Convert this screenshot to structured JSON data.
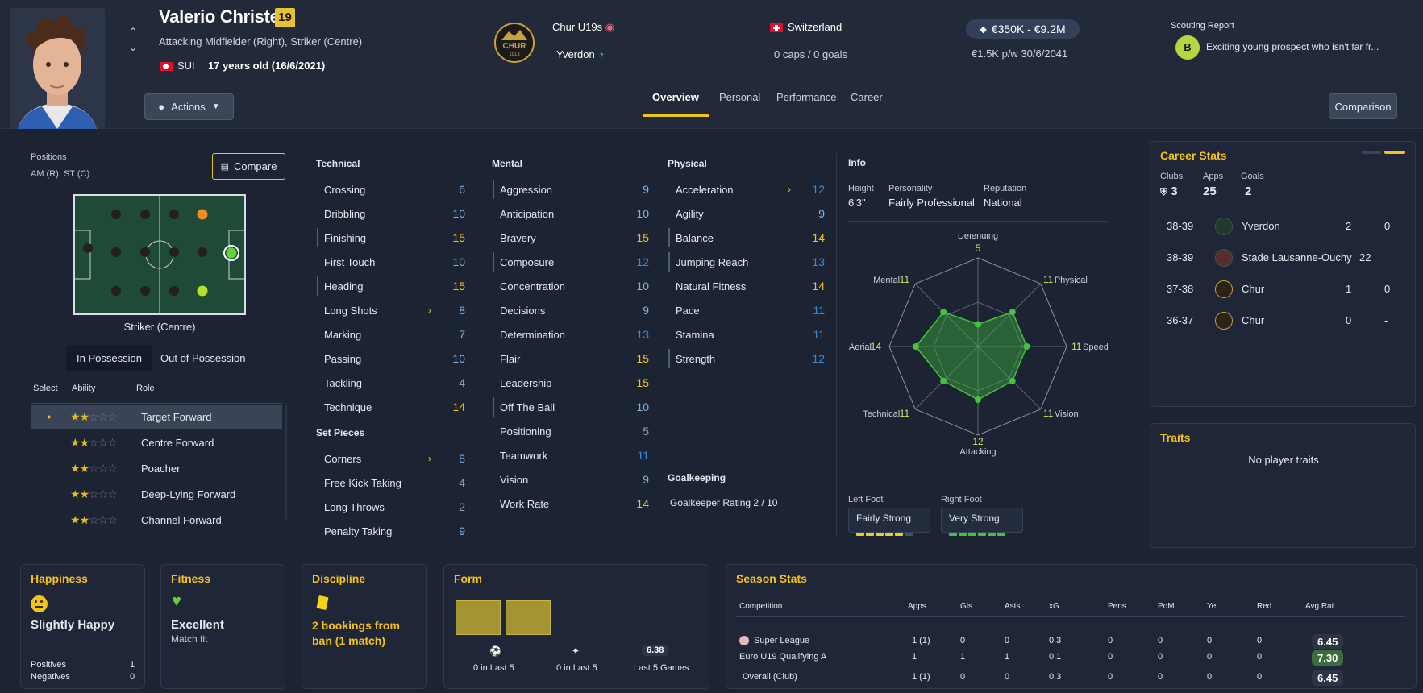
{
  "player": {
    "name": "Valerio Christen",
    "age_badge": "19",
    "positions_text": "Attacking Midfielder (Right), Striker (Centre)",
    "nation_code": "SUI",
    "age_text": "17 years old (16/6/2021)"
  },
  "clubs": {
    "club": "Chur U19s",
    "loan_club": "Yverdon",
    "logo_text": "CHUR",
    "logo_year": "1913"
  },
  "nation": {
    "name": "Switzerland",
    "caps": "0 caps / 0 goals"
  },
  "value": {
    "range": "€350K - €9.2M",
    "wage": "€1.5K p/w 30/6/2041"
  },
  "scouting": {
    "label": "Scouting Report",
    "grade": "B",
    "text": "Exciting young prospect who isn't far fr..."
  },
  "actions_label": "Actions",
  "comparison_label": "Comparison",
  "tabs": [
    "Overview",
    "Personal",
    "Performance",
    "Career"
  ],
  "positions_panel": {
    "label": "Positions",
    "value": "AM (R), ST (C)",
    "compare_label": "Compare",
    "pitch_caption": "Striker (Centre)",
    "in_possession": "In Possession",
    "out_possession": "Out of Possession",
    "headers": [
      "Select",
      "Ability",
      "Role"
    ],
    "roles": [
      {
        "name": "Target Forward",
        "stars": 2,
        "selected": true
      },
      {
        "name": "Centre Forward",
        "stars": 2,
        "selected": false
      },
      {
        "name": "Poacher",
        "stars": 2,
        "selected": false
      },
      {
        "name": "Deep-Lying Forward",
        "stars": 2,
        "selected": false
      },
      {
        "name": "Channel Forward",
        "stars": 2,
        "selected": false
      }
    ]
  },
  "attributes": {
    "technical_title": "Technical",
    "technical": [
      {
        "n": "Crossing",
        "v": "6"
      },
      {
        "n": "Dribbling",
        "v": "10"
      },
      {
        "n": "Finishing",
        "v": "15"
      },
      {
        "n": "First Touch",
        "v": "10"
      },
      {
        "n": "Heading",
        "v": "15"
      },
      {
        "n": "Long Shots",
        "v": "8"
      },
      {
        "n": "Marking",
        "v": "7"
      },
      {
        "n": "Passing",
        "v": "10"
      },
      {
        "n": "Tackling",
        "v": "4"
      },
      {
        "n": "Technique",
        "v": "14"
      }
    ],
    "set_pieces_title": "Set Pieces",
    "set_pieces": [
      {
        "n": "Corners",
        "v": "8"
      },
      {
        "n": "Free Kick Taking",
        "v": "4"
      },
      {
        "n": "Long Throws",
        "v": "2"
      },
      {
        "n": "Penalty Taking",
        "v": "9"
      }
    ],
    "mental_title": "Mental",
    "mental": [
      {
        "n": "Aggression",
        "v": "9"
      },
      {
        "n": "Anticipation",
        "v": "10"
      },
      {
        "n": "Bravery",
        "v": "15"
      },
      {
        "n": "Composure",
        "v": "12"
      },
      {
        "n": "Concentration",
        "v": "10"
      },
      {
        "n": "Decisions",
        "v": "9"
      },
      {
        "n": "Determination",
        "v": "13"
      },
      {
        "n": "Flair",
        "v": "15"
      },
      {
        "n": "Leadership",
        "v": "15"
      },
      {
        "n": "Off The Ball",
        "v": "10"
      },
      {
        "n": "Positioning",
        "v": "5"
      },
      {
        "n": "Teamwork",
        "v": "11"
      },
      {
        "n": "Vision",
        "v": "9"
      },
      {
        "n": "Work Rate",
        "v": "14"
      }
    ],
    "physical_title": "Physical",
    "physical": [
      {
        "n": "Acceleration",
        "v": "12"
      },
      {
        "n": "Agility",
        "v": "9"
      },
      {
        "n": "Balance",
        "v": "14"
      },
      {
        "n": "Jumping Reach",
        "v": "13"
      },
      {
        "n": "Natural Fitness",
        "v": "14"
      },
      {
        "n": "Pace",
        "v": "11"
      },
      {
        "n": "Stamina",
        "v": "11"
      },
      {
        "n": "Strength",
        "v": "12"
      }
    ],
    "gk_title": "Goalkeeping",
    "gk_rating": "Goalkeeper Rating  2 / 10"
  },
  "info": {
    "title": "Info",
    "height_label": "Height",
    "height": "6'3\"",
    "personality_label": "Personality",
    "personality": "Fairly Professional",
    "reputation_label": "Reputation",
    "reputation": "National",
    "radar": [
      {
        "label": "Defending",
        "value": "5"
      },
      {
        "label": "Physical",
        "value": "11"
      },
      {
        "label": "Speed",
        "value": "11"
      },
      {
        "label": "Vision",
        "value": "11"
      },
      {
        "label": "Attacking",
        "value": "12"
      },
      {
        "label": "Technical",
        "value": "11"
      },
      {
        "label": "Aerial",
        "value": "14"
      },
      {
        "label": "Mental",
        "value": "11"
      }
    ],
    "left_foot_label": "Left Foot",
    "left_foot": "Fairly Strong",
    "left_foot_level": 0.8,
    "right_foot_label": "Right Foot",
    "right_foot": "Very Strong",
    "right_foot_level": 1.0
  },
  "career_stats": {
    "title": "Career Stats",
    "clubs_label": "Clubs",
    "clubs": "3",
    "apps_label": "Apps",
    "apps": "25",
    "goals_label": "Goals",
    "goals": "2",
    "rows": [
      {
        "season": "38-39",
        "club": "Yverdon",
        "apps": "2",
        "goals": "0"
      },
      {
        "season": "38-39",
        "club": "Stade Lausanne-Ouchy",
        "apps": "22",
        "goals": ""
      },
      {
        "season": "37-38",
        "club": "Chur",
        "apps": "1",
        "goals": "0"
      },
      {
        "season": "36-37",
        "club": "Chur",
        "apps": "0",
        "goals": "-"
      }
    ]
  },
  "traits": {
    "title": "Traits",
    "text": "No player traits"
  },
  "happiness": {
    "title": "Happiness",
    "value": "Slightly Happy",
    "positives_label": "Positives",
    "positives": "1",
    "negatives_label": "Negatives",
    "negatives": "0"
  },
  "fitness": {
    "title": "Fitness",
    "value": "Excellent",
    "sub": "Match fit"
  },
  "discipline": {
    "title": "Discipline",
    "value": "2 bookings from ban (1 match)"
  },
  "form": {
    "title": "Form",
    "rating": "6.38",
    "goals_label": "0 in Last 5",
    "assists_label": "0 in Last 5",
    "games_label": "Last 5 Games"
  },
  "season_stats": {
    "title": "Season Stats",
    "headers": [
      "Competition",
      "Apps",
      "Gls",
      "Asts",
      "xG",
      "Pens",
      "PoM",
      "Yel",
      "Red",
      "Avg Rat"
    ],
    "rows": [
      [
        "Super League",
        "1 (1)",
        "0",
        "0",
        "0.3",
        "0",
        "0",
        "0",
        "0",
        "6.45"
      ],
      [
        "Euro U19  Qualifying A",
        "1",
        "1",
        "1",
        "0.1",
        "0",
        "0",
        "0",
        "0",
        "7.30"
      ],
      [
        "Overall (Club)",
        "1 (1)",
        "0",
        "0",
        "0.3",
        "0",
        "0",
        "0",
        "0",
        "6.45"
      ]
    ]
  },
  "colors": {
    "accent": "#f4c21c",
    "blue_value": "#2f8fe6",
    "radar_fill": "#3fae3a",
    "pitch": "#1f4a38"
  }
}
